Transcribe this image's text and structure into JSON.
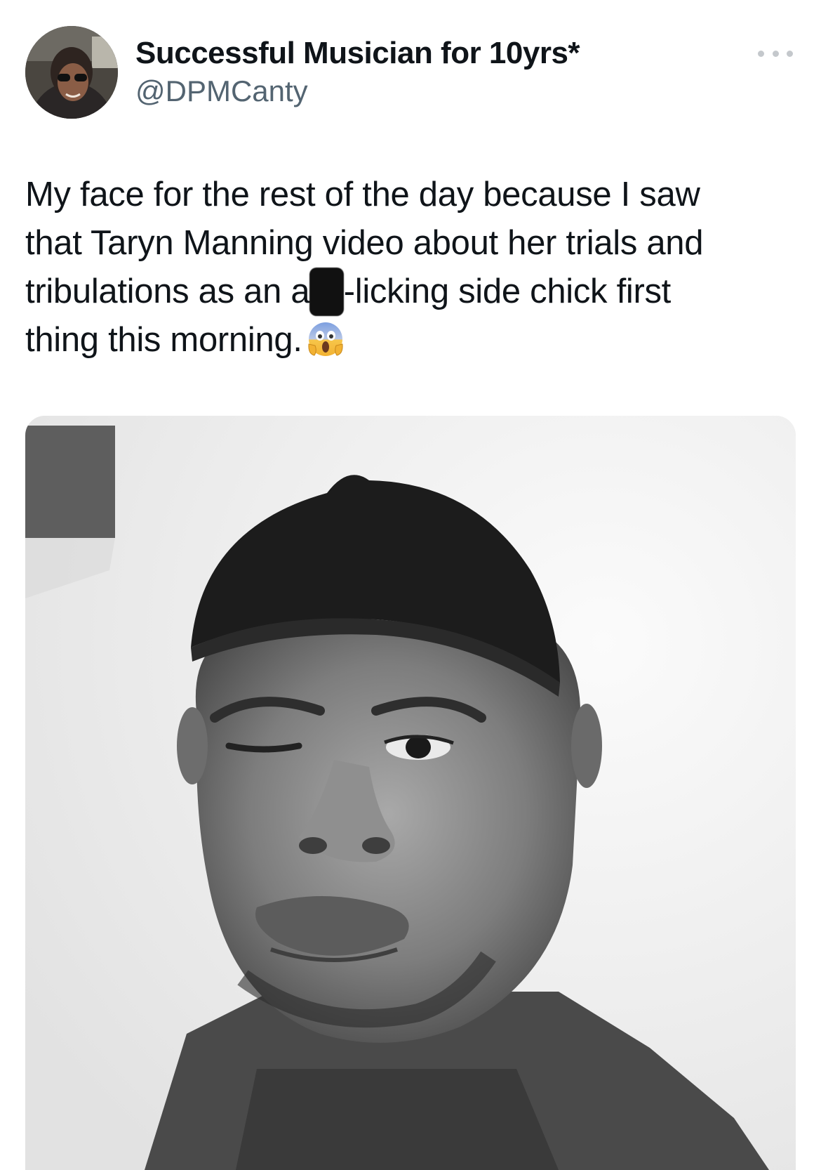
{
  "tweet": {
    "author_name": "Successful Musician for 10yrs*",
    "author_handle": "@DPMCanty",
    "more_icon": "more-horizontal-icon",
    "text_line_1": "My face for the rest of the day because I saw",
    "text_line_2": "that Taryn Manning video about her trials and",
    "text_line_3_before": "tribulations as an a",
    "text_line_3_redacted": "ss",
    "text_line_3_after": "-licking side chick first",
    "text_line_4": "thing this morning.",
    "emoji": "face-screaming-in-fear-emoji"
  },
  "colors": {
    "text": "#0f1419",
    "secondary_text": "#536471",
    "more_dots": "#c4c8cc",
    "redaction": "#111111"
  }
}
